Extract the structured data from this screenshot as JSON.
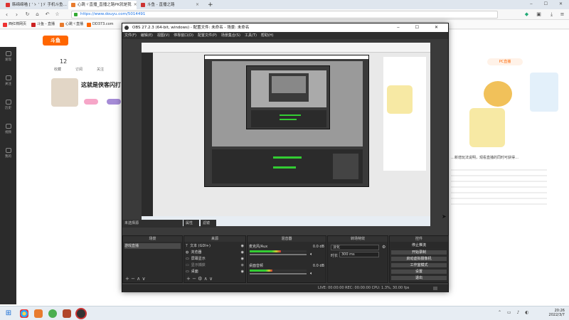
{
  "browser": {
    "tabs": [
      {
        "label": "韩绵绵喵 [ ‘ゝ ‘ ]ゞ 手机斗鱼…",
        "color": "#d33"
      },
      {
        "label": "心跳ヾ直播_直播之路PK就是我",
        "color": "#e87b2e"
      },
      {
        "label": "斗鱼 - 直播之路",
        "color": "#c33"
      }
    ],
    "new_tab": "+",
    "url": "https://www.douyu.com/5014491",
    "bookmarks": [
      "西红柿网页",
      "斗鱼 - 直播",
      "心跳ヾ直播",
      "DD373.com"
    ]
  },
  "page": {
    "follow_count": "12",
    "tags": [
      "收藏",
      "订阅",
      "关注"
    ],
    "streamer_title": "这就是侠客闪打",
    "badge": "PC直播",
    "text_snippet": "…新增玩法说明，观看直播的同时可获得…"
  },
  "leftrail": [
    "发现",
    "关注",
    "历史",
    "视频",
    "我的"
  ],
  "obs": {
    "title": "OBS 27.2.3 (64-bit, windows) - 配置文件: 未命名 - 场景: 未命名",
    "menu": [
      "文件(F)",
      "编辑(E)",
      "视图(V)",
      "停靠窗口(D)",
      "配置文件(P)",
      "场景集合(S)",
      "工具(T)",
      "帮助(H)"
    ],
    "dock_left": "未选择源",
    "dock_prop": "属性",
    "dock_filter": "滤镜",
    "panels": {
      "scenes": {
        "title": "场景",
        "items": [
          "游戏直播"
        ]
      },
      "sources": {
        "title": "来源",
        "items": [
          "文本 (GDI+)",
          "浏览器",
          "屏幕显示",
          "显示捕获",
          "桌面"
        ]
      },
      "mixer": {
        "title": "混音器",
        "channels": [
          {
            "name": "麦克风/Aux",
            "db": "0.0 dB",
            "level": 0.55
          },
          {
            "name": "桌面音频",
            "db": "0.0 dB",
            "level": 0.4
          }
        ]
      },
      "transitions": {
        "title": "转场特效",
        "mode": "淡化",
        "duration_label": "时长",
        "duration": "300 ms"
      },
      "controls": {
        "title": "控件",
        "buttons": [
          "停止推流",
          "开始录制",
          "启动虚拟摄像机",
          "工作室模式",
          "设置",
          "退出"
        ]
      }
    },
    "status": "LIVE: 00:00:00   REC: 00:00:00   CPU: 1.3%, 30.00 fps"
  },
  "taskbar": {
    "time": "20:26",
    "date": "2022/3/7"
  }
}
